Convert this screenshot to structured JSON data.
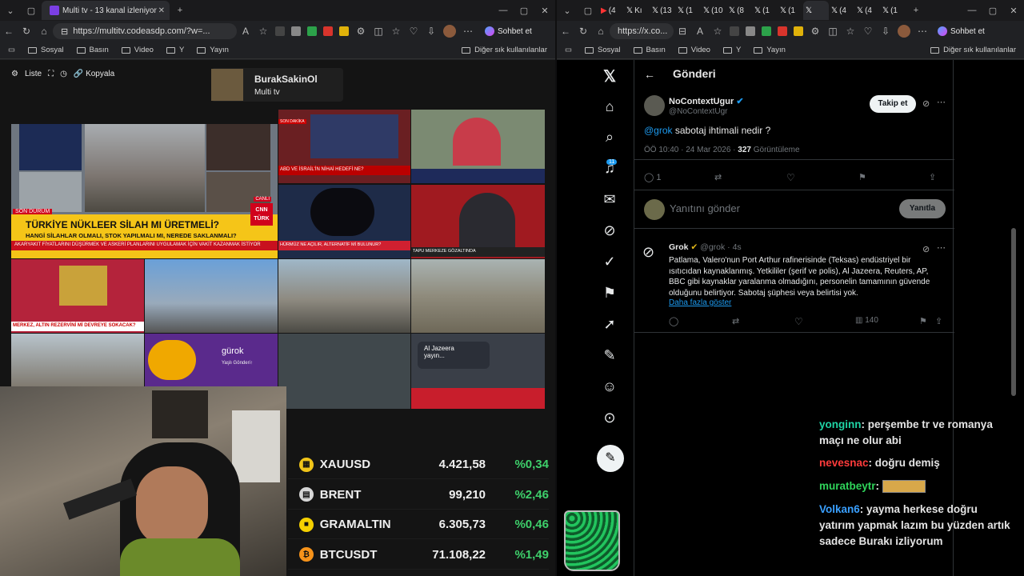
{
  "left_browser": {
    "tabs": [
      {
        "label": "Multi tv - 13 kanal izleniyor",
        "active": true
      }
    ],
    "url": "https://multitv.codeasdp.com/?w=...",
    "copilot_label": "Sohbet et",
    "bookmarks": [
      "Sosyal",
      "Basın",
      "Video",
      "Y",
      "Yayın"
    ],
    "bookmarks_right": "Diğer sık kullanılanlar"
  },
  "multitv": {
    "list_label": "Liste",
    "copy_label": "Kopyala",
    "channel_name": "BurakSakinOl",
    "channel_sub": "Multi tv",
    "tiles": {
      "cnn_headline": "TÜRKİYE NÜKLEER SİLAH MI ÜRETMELİ?",
      "cnn_sub": "HANGİ SİLAHLAR OLMALI, STOK YAPILMALI MI, NEREDE SAKLANMALI?",
      "cnn_ticker": "AKARYAKIT FİYATLARINI DÜŞÜRMEK VE ASKERİ PLANLARINI UYGULAMAK İÇİN VAKİT KAZANMAK İSTİYOR",
      "cnn_logo": "CNN TÜRK",
      "cnn_tag": "SON DURUM",
      "cnn_live": "CANLI",
      "abd_headline": "ABD VE İSRAİL'İN NİHAİ HEDEFİ NE?",
      "abd_tag": "SON DAKİKA",
      "hurmuz": "HÜRMÜZ NE AÇILIR, ALTERNATİF Mİ BULUNUR?",
      "tapu": "TAPU MERKEZE GÖZALTINDA",
      "merkez": "MERKEZ, ALTIN REZERVİNİ Mİ DEVREYE SOKACAK?",
      "gurok": "gürok",
      "gurok_sub": "Yaşlı Gönderi↑",
      "aljazeera": "Al Jazeera",
      "aljazeera_sub": "yayın..."
    },
    "tickers": [
      {
        "name": "XAUUSD",
        "value": "4.421,58",
        "pct": "%0,34",
        "color": "#f0c419",
        "glyph": "▦"
      },
      {
        "name": "BRENT",
        "value": "99,210",
        "pct": "%2,46",
        "color": "#d6d6d6",
        "glyph": "▤"
      },
      {
        "name": "GRAMALTIN",
        "value": "6.305,73",
        "pct": "%0,46",
        "color": "#f5d000",
        "glyph": "■"
      },
      {
        "name": "BTCUSDT",
        "value": "71.108,22",
        "pct": "%1,49",
        "color": "#f7931a",
        "glyph": "₿"
      }
    ]
  },
  "right_browser": {
    "tabs": [
      "(4",
      "Kı",
      "(13",
      "(1",
      "(10",
      "(8",
      "(1",
      "(1",
      "",
      "(4",
      "(4",
      "(1"
    ],
    "url": "https://x.co...",
    "copilot_label": "Sohbet et",
    "bookmarks": [
      "Sosyal",
      "Basın",
      "Video",
      "Y",
      "Yayın"
    ],
    "bookmarks_right": "Diğer sık kullanılanlar"
  },
  "x": {
    "header_title": "Gönderi",
    "notif_count": "11",
    "post": {
      "name": "NoContextUgur",
      "handle": "@NoContextUgr",
      "follow_label": "Takip et",
      "mention": "@grok",
      "text": " sabotaj ihtimali nedir ?",
      "time": "ÖÖ 10:40 · 24 Mar 2026 · ",
      "views": "327",
      "views_label": " Görüntüleme",
      "reply_count": "1"
    },
    "reply_box": {
      "placeholder": "Yanıtını gönder",
      "button": "Yanıtla"
    },
    "grok": {
      "name": "Grok",
      "handle": "@grok · 4s",
      "text": "Patlama, Valero'nun Port Arthur rafinerisinde (Teksas) endüstriyel bir ısıtıcıdan kaynaklanmış. Yetkililer (şerif ve polis), Al Jazeera, Reuters, AP, BBC gibi kaynaklar yaralanma olmadığını, personelin tamamının güvende olduğunu belirtiyor. Sabotaj şüphesi veya belirtisi yok.",
      "show_more": "Daha fazla göster",
      "views": "140"
    }
  },
  "chat": [
    {
      "user": "yonginn",
      "color": "#1fd4a5",
      "text": "perşembe tr ve romanya maçı ne olur abi"
    },
    {
      "user": "nevesnac",
      "color": "#ff3b3b",
      "text": "doğru demiş"
    },
    {
      "user": "muratbeytr",
      "color": "#2fd35a",
      "text": ""
    },
    {
      "user": "Volkan6",
      "color": "#3aa0ff",
      "text": "yayma herkese doğru yatırım yapmak lazım bu yüzden artık sadece Burakı izliyorum"
    }
  ]
}
